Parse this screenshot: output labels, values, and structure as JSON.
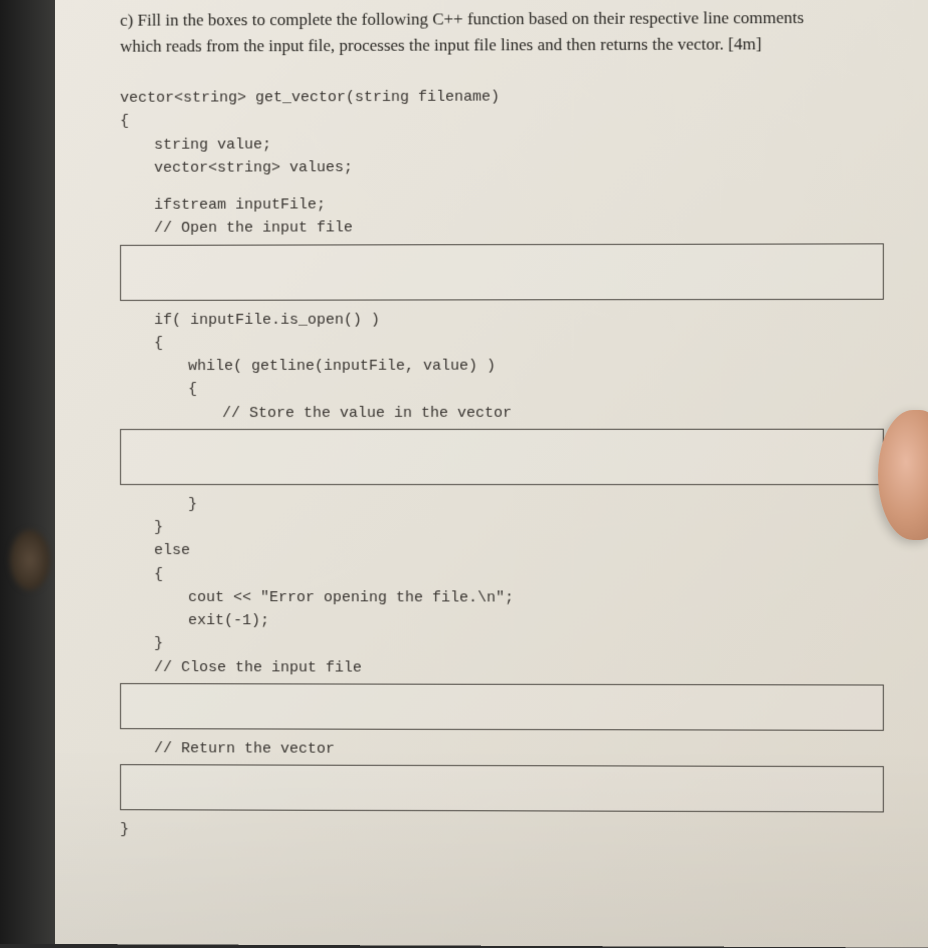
{
  "question": {
    "label": "c)",
    "text_line1": "c) Fill in the boxes to complete the following C++ function based on their respective line comments",
    "text_line2": "which reads from the input file, processes the input file lines and then returns the vector. [4m]"
  },
  "code": {
    "sig": "vector<string> get_vector(string filename)",
    "open_brace": "{",
    "decl1": "string value;",
    "decl2": "vector<string> values;",
    "decl3": "ifstream inputFile;",
    "comment_open": "// Open the input file",
    "if_line": "if( inputFile.is_open() )",
    "if_brace": "{",
    "while_line": "while( getline(inputFile, value) )",
    "while_brace": "{",
    "comment_store": "// Store the value in the vector",
    "while_close": "}",
    "if_close": "}",
    "else_kw": "else",
    "else_brace": "{",
    "cout_line": "cout << \"Error opening the file.\\n\";",
    "exit_line": "exit(-1);",
    "else_close": "}",
    "comment_close": "// Close the input file",
    "comment_return": "// Return the vector",
    "fn_close": "}"
  },
  "answers": {
    "box1": "",
    "box2": "",
    "box3": "",
    "box4": ""
  }
}
